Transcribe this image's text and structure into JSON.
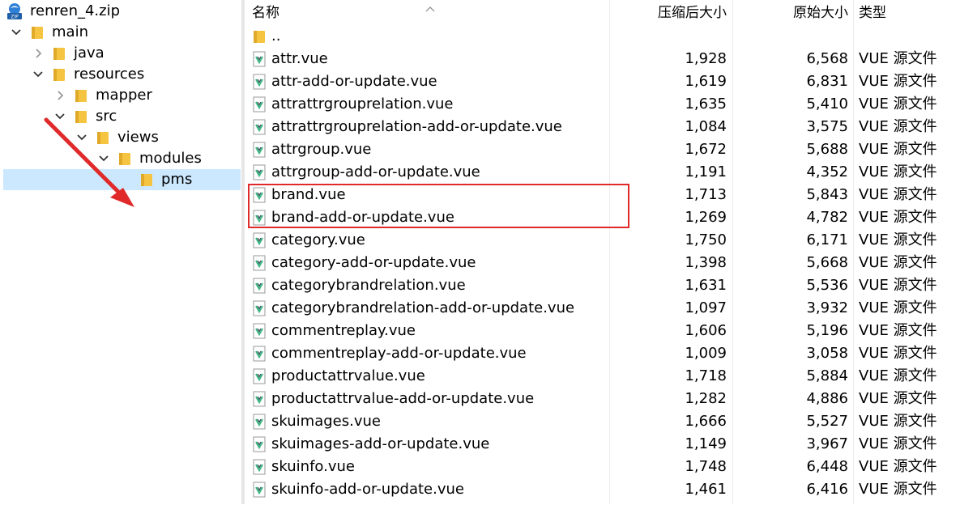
{
  "tree": {
    "root": {
      "label": "renren_4.zip",
      "icon": "zip-icon"
    },
    "nodes": [
      {
        "label": "main",
        "state": "expanded"
      },
      {
        "label": "java",
        "state": "collapsed"
      },
      {
        "label": "resources",
        "state": "expanded"
      },
      {
        "label": "mapper",
        "state": "collapsed"
      },
      {
        "label": "src",
        "state": "expanded"
      },
      {
        "label": "views",
        "state": "expanded"
      },
      {
        "label": "modules",
        "state": "expanded"
      },
      {
        "label": "pms",
        "state": "selected"
      }
    ]
  },
  "list": {
    "columns": {
      "name": "名称",
      "compressed": "压缩后大小",
      "original": "原始大小",
      "type": "类型"
    },
    "parent_dir": "..",
    "rows": [
      {
        "name": "attr.vue",
        "compressed": "1,928",
        "original": "6,568",
        "type": "VUE 源文件"
      },
      {
        "name": "attr-add-or-update.vue",
        "compressed": "1,619",
        "original": "6,831",
        "type": "VUE 源文件"
      },
      {
        "name": "attrattrgrouprelation.vue",
        "compressed": "1,635",
        "original": "5,410",
        "type": "VUE 源文件"
      },
      {
        "name": "attrattrgrouprelation-add-or-update.vue",
        "compressed": "1,084",
        "original": "3,575",
        "type": "VUE 源文件"
      },
      {
        "name": "attrgroup.vue",
        "compressed": "1,672",
        "original": "5,688",
        "type": "VUE 源文件"
      },
      {
        "name": "attrgroup-add-or-update.vue",
        "compressed": "1,191",
        "original": "4,352",
        "type": "VUE 源文件"
      },
      {
        "name": "brand.vue",
        "compressed": "1,713",
        "original": "5,843",
        "type": "VUE 源文件"
      },
      {
        "name": "brand-add-or-update.vue",
        "compressed": "1,269",
        "original": "4,782",
        "type": "VUE 源文件"
      },
      {
        "name": "category.vue",
        "compressed": "1,750",
        "original": "6,171",
        "type": "VUE 源文件"
      },
      {
        "name": "category-add-or-update.vue",
        "compressed": "1,398",
        "original": "5,668",
        "type": "VUE 源文件"
      },
      {
        "name": "categorybrandrelation.vue",
        "compressed": "1,631",
        "original": "5,536",
        "type": "VUE 源文件"
      },
      {
        "name": "categorybrandrelation-add-or-update.vue",
        "compressed": "1,097",
        "original": "3,932",
        "type": "VUE 源文件"
      },
      {
        "name": "commentreplay.vue",
        "compressed": "1,606",
        "original": "5,196",
        "type": "VUE 源文件"
      },
      {
        "name": "commentreplay-add-or-update.vue",
        "compressed": "1,009",
        "original": "3,058",
        "type": "VUE 源文件"
      },
      {
        "name": "productattrvalue.vue",
        "compressed": "1,718",
        "original": "5,884",
        "type": "VUE 源文件"
      },
      {
        "name": "productattrvalue-add-or-update.vue",
        "compressed": "1,282",
        "original": "4,886",
        "type": "VUE 源文件"
      },
      {
        "name": "skuimages.vue",
        "compressed": "1,666",
        "original": "5,527",
        "type": "VUE 源文件"
      },
      {
        "name": "skuimages-add-or-update.vue",
        "compressed": "1,149",
        "original": "3,967",
        "type": "VUE 源文件"
      },
      {
        "name": "skuinfo.vue",
        "compressed": "1,748",
        "original": "6,448",
        "type": "VUE 源文件"
      },
      {
        "name": "skuinfo-add-or-update.vue",
        "compressed": "1,461",
        "original": "6,416",
        "type": "VUE 源文件"
      }
    ]
  },
  "colors": {
    "selection": "#cce8ff",
    "annotation": "#e02a2a",
    "folder": "#f5c542",
    "vue_icon": "#41b883"
  }
}
